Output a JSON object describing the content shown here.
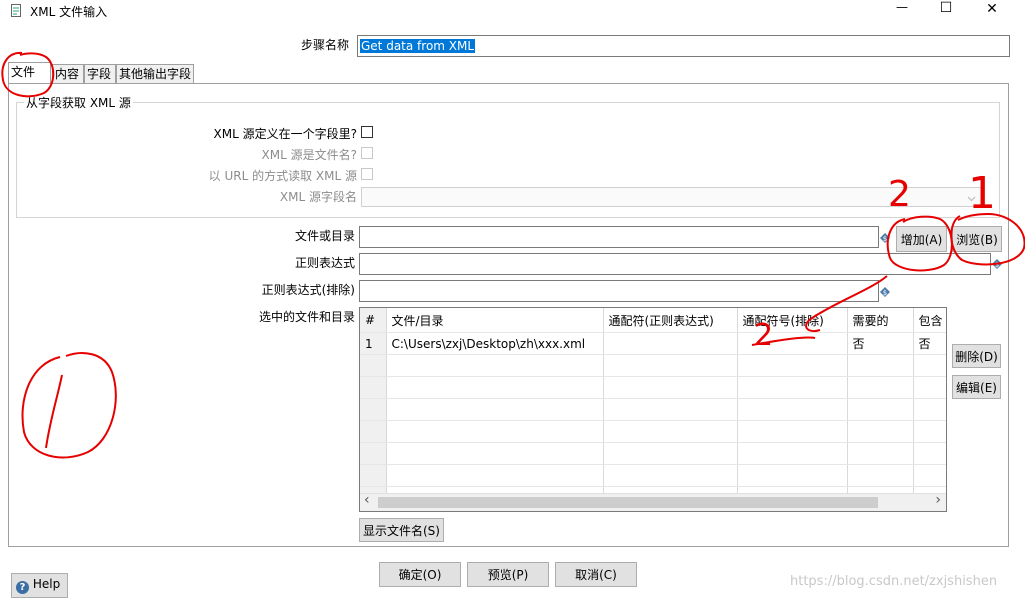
{
  "window": {
    "title": "XML 文件输入",
    "minimize": "—",
    "maximize": "☐",
    "close": "✕"
  },
  "step_name": {
    "label": "步骤名称",
    "value": "Get data from XML"
  },
  "tabs": [
    {
      "label": "文件"
    },
    {
      "label": "内容"
    },
    {
      "label": "字段"
    },
    {
      "label": "其他输出字段"
    }
  ],
  "source_group": {
    "title": "从字段获取 XML 源",
    "xml_in_field_label": "XML 源定义在一个字段里?",
    "xml_is_filename_label": "XML 源是文件名?",
    "read_url_label": "以 URL 的方式读取 XML 源",
    "source_field_label": "XML 源字段名"
  },
  "file": {
    "file_or_dir_label": "文件或目录",
    "add_button": "增加(A)",
    "browse_button": "浏览(B)",
    "regex_label": "正则表达式",
    "regex_exclude_label": "正则表达式(排除)",
    "selected_label": "选中的文件和目录",
    "var_icon": "$",
    "delete_button": "删除(D)",
    "edit_button": "编辑(E)",
    "show_filenames_button": "显示文件名(S)"
  },
  "table": {
    "columns": [
      "#",
      "文件/目录",
      "通配符(正则表达式)",
      "通配符号(排除)",
      "需要的",
      "包含"
    ],
    "rows": [
      [
        "1",
        "C:\\Users\\zxj\\Desktop\\zh\\xxx.xml",
        "",
        "",
        "否",
        "否"
      ]
    ],
    "scroll_left": "‹",
    "scroll_right": "›"
  },
  "footer": {
    "ok": "确定(O)",
    "preview": "预览(P)",
    "cancel": "取消(C)",
    "help": "Help",
    "help_icon": "?"
  },
  "watermark": "https://blog.csdn.net/zxjshishen",
  "annotations": {
    "mark_1": "1",
    "mark_2": "2",
    "color": "#e60000"
  }
}
